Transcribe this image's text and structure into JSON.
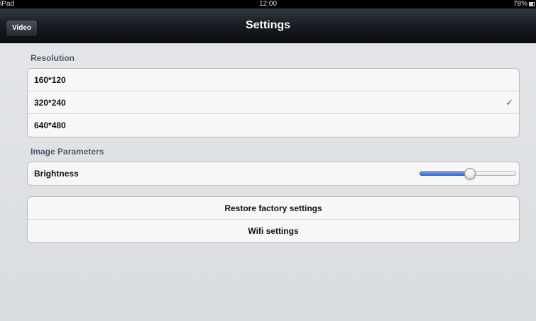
{
  "status_bar": {
    "carrier": "iPad",
    "time": "12:00",
    "battery": "78%",
    "battery_level": 0.78
  },
  "nav": {
    "title": "Settings",
    "back_label": "Video"
  },
  "resolution": {
    "header": "Resolution",
    "options": [
      "160*120",
      "320*240",
      "640*480"
    ],
    "selected": "320*240",
    "check_glyph": "✓"
  },
  "image_parameters": {
    "header": "Image Parameters",
    "brightness_label": "Brightness",
    "brightness_value": 0.52
  },
  "actions": {
    "restore_label": "Restore factory settings",
    "wifi_label": "Wifi settings"
  },
  "colors": {
    "checkmark": "#3a5a96",
    "slider_fill": "#2f6bd8",
    "nav_bar": "#1a1e24",
    "background": "#dfe1e4"
  }
}
